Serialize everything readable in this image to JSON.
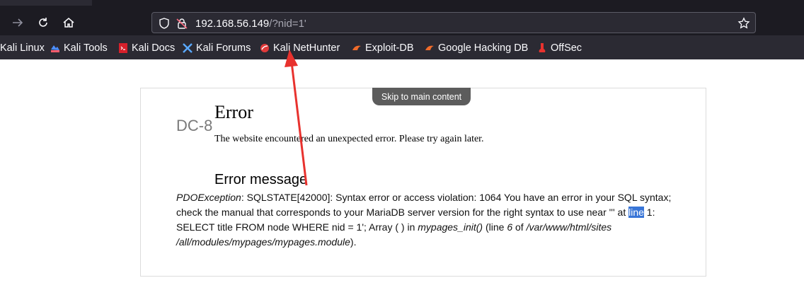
{
  "browser": {
    "url": {
      "host": "192.168.56.149",
      "path": "/?nid=1'"
    },
    "bookmarks": [
      {
        "label": "Kali Linux",
        "icon": "kali-linux-icon"
      },
      {
        "label": "Kali Tools",
        "icon": "kali-tools-icon"
      },
      {
        "label": "Kali Docs",
        "icon": "kali-docs-icon"
      },
      {
        "label": "Kali Forums",
        "icon": "kali-forums-icon"
      },
      {
        "label": "Kali NetHunter",
        "icon": "kali-nethunter-icon"
      },
      {
        "label": "Exploit-DB",
        "icon": "exploit-db-icon"
      },
      {
        "label": "Google Hacking DB",
        "icon": "google-hacking-db-icon"
      },
      {
        "label": "OffSec",
        "icon": "offsec-icon"
      }
    ]
  },
  "page": {
    "skip_link": "Skip to main content",
    "site_name": "DC-8",
    "error_title": "Error",
    "error_desc": "The website encountered an unexpected error. Please try again later.",
    "error_message_heading": "Error message",
    "error_message": {
      "exception": "PDOException",
      "part1": ": SQLSTATE[42000]: Syntax error or access violation: 1064 You have an error in your SQL syntax; check the manual that corresponds to your MariaDB server version for the right syntax to use near ''' at ",
      "selected_word": "line",
      "part2": " 1: SELECT title FROM node WHERE nid = 1'; Array ( ) in ",
      "function": "mypages_init()",
      "part3": " (line ",
      "line_number": "6",
      "part4": " of ",
      "file": "/var/www/html/sites /all/modules/mypages/mypages.module",
      "part5": ")."
    }
  },
  "colors": {
    "chrome_bg": "#1c1b22",
    "urlbar_bg": "#2b2a33",
    "selection": "#3875d7",
    "annotation_arrow": "#e8322e"
  }
}
